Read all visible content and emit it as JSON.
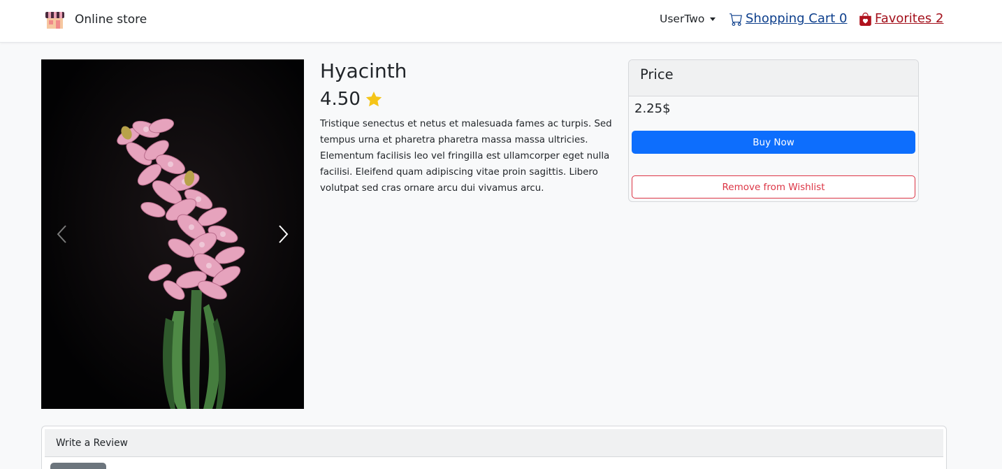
{
  "navbar": {
    "brand": "Online store",
    "user": "UserTwo",
    "cart_label": "Shopping Cart 0",
    "favorites_label": "Favorites 2"
  },
  "product": {
    "title": "Hyacinth",
    "rating": "4.50",
    "description": "Tristique senectus et netus et malesuada fames ac turpis. Sed tempus urna et pharetra pharetra massa massa ultricies. Elementum facilisis leo vel fringilla est ullamcorper eget nulla facilisi. Eleifend quam adipiscing vitae proin sagittis. Libero volutpat sed cras ornare arcu dui vivamus arcu."
  },
  "price_card": {
    "header": "Price",
    "price": "2.25$",
    "buy_label": "Buy Now",
    "remove_label": "Remove from Wishlist"
  },
  "review": {
    "header": "Write a Review"
  },
  "icons": {
    "brand": "store-icon",
    "cart": "cart-icon",
    "favorites": "shopping-bag-heart-icon",
    "rating": "star-icon",
    "carousel_prev": "chevron-left-icon",
    "carousel_next": "chevron-right-icon"
  },
  "colors": {
    "primary": "#0d6efd",
    "danger": "#dc3545",
    "cart_link": "#0d3f8c",
    "favorites_link": "#a3111c",
    "star": "#f5c518"
  }
}
